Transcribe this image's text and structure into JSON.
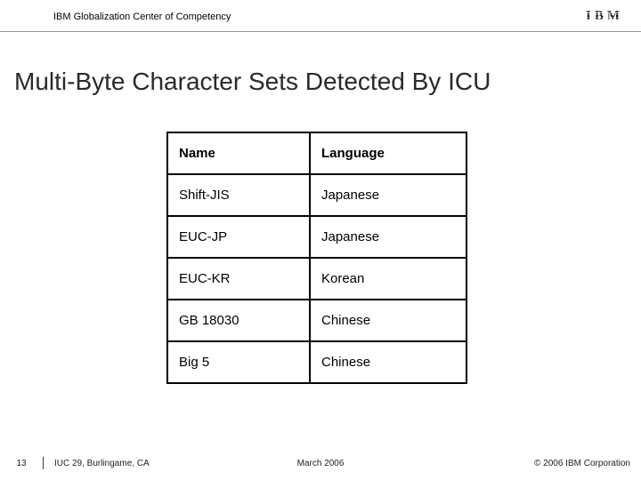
{
  "header": {
    "org": "IBM Globalization Center of Competency",
    "logo_text": "IBM"
  },
  "title": "Multi-Byte Character Sets Detected By ICU",
  "table": {
    "headers": {
      "name": "Name",
      "language": "Language"
    },
    "rows": [
      {
        "name": "Shift-JIS",
        "language": "Japanese"
      },
      {
        "name": "EUC-JP",
        "language": "Japanese"
      },
      {
        "name": "EUC-KR",
        "language": "Korean"
      },
      {
        "name": "GB 18030",
        "language": "Chinese"
      },
      {
        "name": "Big 5",
        "language": "Chinese"
      }
    ]
  },
  "footer": {
    "page": "13",
    "venue": "IUC 29, Burlingame, CA",
    "date": "March 2006",
    "copyright": "© 2006 IBM Corporation"
  }
}
